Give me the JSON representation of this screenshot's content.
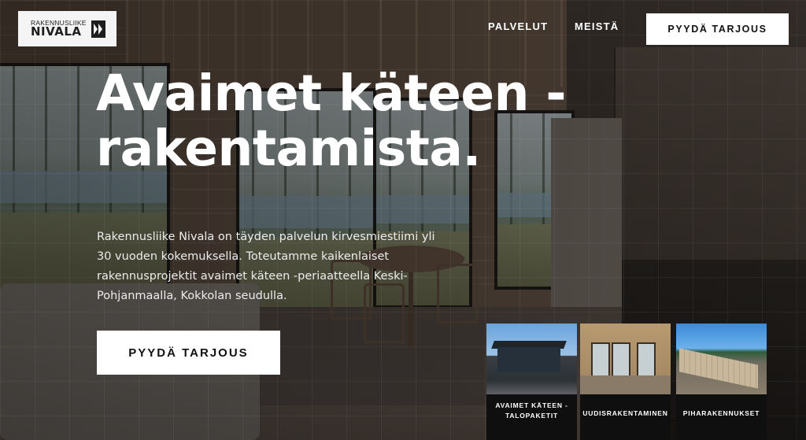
{
  "header": {
    "logo": {
      "line1": "RAKENNUSLIIKE",
      "line2": "NIVALA"
    },
    "nav": [
      {
        "label": "PALVELUT"
      },
      {
        "label": "MEISTÄ"
      }
    ],
    "cta_label": "PYYDÄ TARJOUS"
  },
  "hero": {
    "title_line1": "Avaimet käteen -",
    "title_line2": "rakentamista.",
    "description": "Rakennusliike Nivala on täyden palvelun kirvesmiestiimi yli 30 vuoden kokemuksella. Toteutamme kaikenlaiset rakennusprojektit avaimet käteen -periaatteella Keski-Pohjanmaalla, Kokkolan seudulla.",
    "cta_label": "PYYDÄ TARJOUS"
  },
  "services": [
    {
      "label_line1": "AVAIMET KÄTEEN -",
      "label_line2": "TALOPAKETIT",
      "image_icon": "house-photo"
    },
    {
      "label_line1": "UUDISRAKENTAMINEN",
      "label_line2": "",
      "image_icon": "interior-photo"
    },
    {
      "label_line1": "PIHARAKENNUKSET",
      "label_line2": "",
      "image_icon": "construction-site-photo"
    }
  ],
  "colors": {
    "button_bg": "#ffffff",
    "button_text": "#111111",
    "text_light": "#ffffff",
    "card_bg": "#0f0f0f"
  }
}
